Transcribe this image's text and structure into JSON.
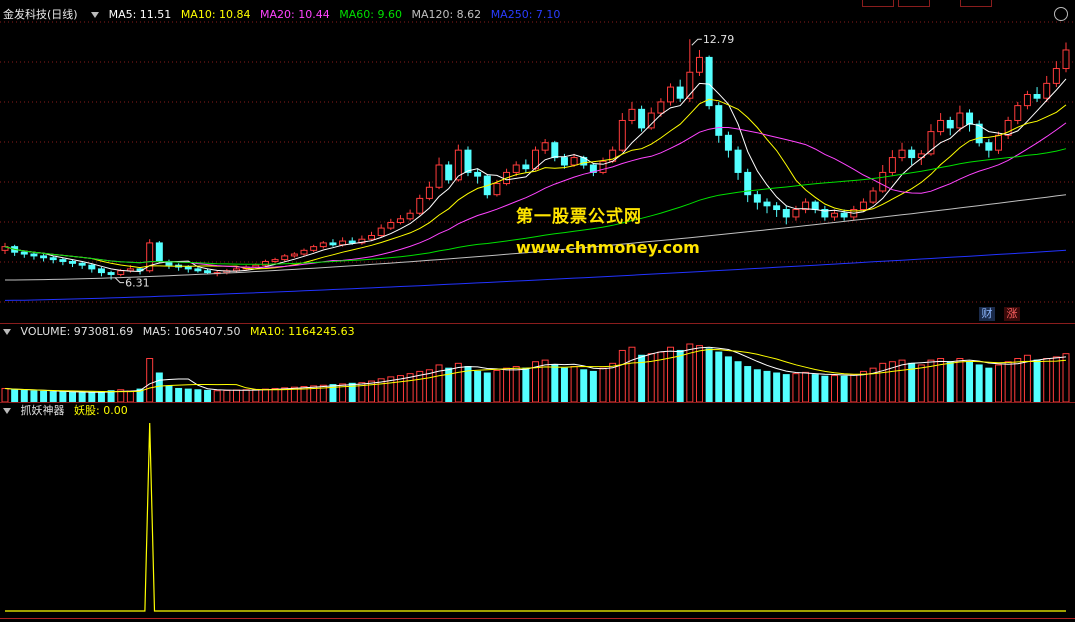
{
  "price_header": {
    "title": "金发科技(日线)",
    "ma5": "MA5: 11.51",
    "ma10": "MA10: 10.84",
    "ma20": "MA20: 10.44",
    "ma60": "MA60: 9.60",
    "ma120": "MA120: 8.62",
    "ma250": "MA250: 7.10"
  },
  "volume_header": {
    "volume": "VOLUME: 973081.69",
    "ma5": "MA5: 1065407.50",
    "ma10": "MA10: 1164245.63"
  },
  "indicator_header": {
    "name": "抓妖神器",
    "value": "妖股: 0.00"
  },
  "annotations": {
    "high": "12.79",
    "low": "6.31"
  },
  "watermark": {
    "line1": "第一股票公式网",
    "line2": "www.chnmoney.com"
  },
  "badges": {
    "cai": "财",
    "zhang": "涨"
  },
  "colors": {
    "up": "#ff3c3c",
    "down": "#54ffff",
    "ma5": "#ffffff",
    "ma10": "#ffff00",
    "ma20": "#ff44ff",
    "ma60": "#00e000",
    "ma120": "#c0c0c0",
    "ma250": "#2233ff",
    "grid": "#8a1d1d",
    "indicator": "#ffff00"
  },
  "chart_data": [
    {
      "type": "candlestick",
      "title": "金发科技(日线)",
      "price_range": [
        5.6,
        13.2
      ],
      "grid": true,
      "annotations": [
        {
          "label": "12.79",
          "kind": "high"
        },
        {
          "label": "6.31",
          "kind": "low"
        }
      ],
      "candles": [
        [
          7.1,
          7.2,
          7.3,
          7.0
        ],
        [
          7.2,
          7.05,
          7.25,
          6.95
        ],
        [
          7.05,
          7.0,
          7.1,
          6.9
        ],
        [
          7.0,
          6.95,
          7.05,
          6.85
        ],
        [
          6.95,
          6.9,
          7.0,
          6.8
        ],
        [
          6.9,
          6.85,
          6.95,
          6.75
        ],
        [
          6.85,
          6.8,
          6.9,
          6.7
        ],
        [
          6.8,
          6.75,
          6.85,
          6.65
        ],
        [
          6.75,
          6.7,
          6.8,
          6.6
        ],
        [
          6.7,
          6.6,
          6.75,
          6.5
        ],
        [
          6.6,
          6.5,
          6.65,
          6.4
        ],
        [
          6.5,
          6.45,
          6.55,
          6.31
        ],
        [
          6.45,
          6.55,
          6.6,
          6.4
        ],
        [
          6.55,
          6.6,
          6.7,
          6.5
        ],
        [
          6.6,
          6.55,
          6.65,
          6.45
        ],
        [
          6.55,
          7.3,
          7.4,
          6.5
        ],
        [
          7.3,
          6.8,
          7.35,
          6.75
        ],
        [
          6.8,
          6.7,
          6.85,
          6.6
        ],
        [
          6.7,
          6.65,
          6.75,
          6.55
        ],
        [
          6.65,
          6.6,
          6.7,
          6.5
        ],
        [
          6.6,
          6.55,
          6.65,
          6.5
        ],
        [
          6.55,
          6.5,
          6.6,
          6.45
        ],
        [
          6.5,
          6.5,
          6.55,
          6.4
        ],
        [
          6.5,
          6.55,
          6.6,
          6.45
        ],
        [
          6.55,
          6.6,
          6.65,
          6.5
        ],
        [
          6.6,
          6.65,
          6.7,
          6.55
        ],
        [
          6.65,
          6.7,
          6.75,
          6.6
        ],
        [
          6.7,
          6.8,
          6.85,
          6.65
        ],
        [
          6.8,
          6.85,
          6.9,
          6.75
        ],
        [
          6.85,
          6.95,
          7.0,
          6.8
        ],
        [
          6.95,
          7.0,
          7.05,
          6.9
        ],
        [
          7.0,
          7.1,
          7.15,
          6.95
        ],
        [
          7.1,
          7.2,
          7.25,
          7.05
        ],
        [
          7.2,
          7.3,
          7.35,
          7.15
        ],
        [
          7.3,
          7.25,
          7.4,
          7.2
        ],
        [
          7.25,
          7.35,
          7.45,
          7.2
        ],
        [
          7.35,
          7.3,
          7.45,
          7.25
        ],
        [
          7.3,
          7.4,
          7.5,
          7.25
        ],
        [
          7.4,
          7.5,
          7.6,
          7.35
        ],
        [
          7.5,
          7.7,
          7.8,
          7.45
        ],
        [
          7.7,
          7.85,
          7.95,
          7.65
        ],
        [
          7.85,
          7.95,
          8.05,
          7.8
        ],
        [
          7.95,
          8.1,
          8.2,
          7.9
        ],
        [
          8.1,
          8.5,
          8.6,
          8.05
        ],
        [
          8.5,
          8.8,
          8.95,
          8.45
        ],
        [
          8.8,
          9.4,
          9.6,
          8.75
        ],
        [
          9.4,
          9.0,
          9.5,
          8.9
        ],
        [
          9.0,
          9.8,
          9.95,
          8.95
        ],
        [
          9.8,
          9.2,
          9.9,
          9.1
        ],
        [
          9.2,
          9.1,
          9.3,
          8.9
        ],
        [
          9.1,
          8.6,
          9.15,
          8.5
        ],
        [
          8.6,
          8.9,
          9.0,
          8.55
        ],
        [
          8.9,
          9.2,
          9.3,
          8.85
        ],
        [
          9.2,
          9.4,
          9.5,
          9.1
        ],
        [
          9.4,
          9.3,
          9.55,
          9.2
        ],
        [
          9.3,
          9.8,
          9.9,
          9.25
        ],
        [
          9.8,
          10.0,
          10.1,
          9.7
        ],
        [
          10.0,
          9.6,
          10.05,
          9.5
        ],
        [
          9.6,
          9.4,
          9.7,
          9.3
        ],
        [
          9.4,
          9.6,
          9.7,
          9.35
        ],
        [
          9.6,
          9.4,
          9.65,
          9.3
        ],
        [
          9.4,
          9.2,
          9.45,
          9.1
        ],
        [
          9.2,
          9.5,
          9.6,
          9.15
        ],
        [
          9.5,
          9.8,
          9.9,
          9.45
        ],
        [
          9.8,
          10.6,
          10.8,
          9.75
        ],
        [
          10.6,
          10.9,
          11.1,
          10.5
        ],
        [
          10.9,
          10.4,
          11.0,
          10.3
        ],
        [
          10.4,
          10.8,
          10.95,
          10.35
        ],
        [
          10.8,
          11.1,
          11.2,
          10.7
        ],
        [
          11.1,
          11.5,
          11.6,
          11.0
        ],
        [
          11.5,
          11.2,
          11.7,
          11.1
        ],
        [
          11.2,
          11.9,
          12.79,
          11.1
        ],
        [
          11.9,
          12.3,
          12.5,
          11.8
        ],
        [
          12.3,
          11.0,
          12.35,
          10.9
        ],
        [
          11.0,
          10.2,
          11.1,
          10.0
        ],
        [
          10.2,
          9.8,
          10.3,
          9.6
        ],
        [
          9.8,
          9.2,
          9.9,
          9.0
        ],
        [
          9.2,
          8.6,
          9.3,
          8.4
        ],
        [
          8.6,
          8.4,
          8.7,
          8.2
        ],
        [
          8.4,
          8.3,
          8.5,
          8.1
        ],
        [
          8.3,
          8.2,
          8.4,
          8.0
        ],
        [
          8.2,
          8.0,
          8.3,
          7.8
        ],
        [
          8.0,
          8.2,
          8.3,
          7.9
        ],
        [
          8.2,
          8.4,
          8.5,
          8.1
        ],
        [
          8.4,
          8.2,
          8.45,
          8.1
        ],
        [
          8.2,
          8.0,
          8.3,
          7.9
        ],
        [
          8.0,
          8.1,
          8.2,
          7.9
        ],
        [
          8.1,
          8.0,
          8.2,
          7.9
        ],
        [
          8.0,
          8.2,
          8.3,
          7.9
        ],
        [
          8.2,
          8.4,
          8.5,
          8.15
        ],
        [
          8.4,
          8.7,
          8.8,
          8.35
        ],
        [
          8.7,
          9.2,
          9.4,
          8.65
        ],
        [
          9.2,
          9.6,
          9.8,
          9.1
        ],
        [
          9.6,
          9.8,
          10.0,
          9.5
        ],
        [
          9.8,
          9.6,
          9.9,
          9.4
        ],
        [
          9.6,
          9.7,
          9.8,
          9.4
        ],
        [
          9.7,
          10.3,
          10.5,
          9.65
        ],
        [
          10.3,
          10.6,
          10.8,
          10.2
        ],
        [
          10.6,
          10.4,
          10.7,
          10.2
        ],
        [
          10.4,
          10.8,
          11.0,
          10.3
        ],
        [
          10.8,
          10.5,
          10.9,
          10.3
        ],
        [
          10.5,
          10.0,
          10.6,
          9.9
        ],
        [
          10.0,
          9.8,
          10.1,
          9.6
        ],
        [
          9.8,
          10.2,
          10.3,
          9.7
        ],
        [
          10.2,
          10.6,
          10.7,
          10.1
        ],
        [
          10.6,
          11.0,
          11.1,
          10.5
        ],
        [
          11.0,
          11.3,
          11.4,
          10.9
        ],
        [
          11.3,
          11.2,
          11.5,
          11.1
        ],
        [
          11.2,
          11.6,
          11.8,
          11.1
        ],
        [
          11.6,
          12.0,
          12.2,
          11.5
        ],
        [
          12.0,
          12.5,
          12.7,
          11.9
        ]
      ],
      "ma_series": [
        {
          "name": "MA5",
          "last": 11.51
        },
        {
          "name": "MA10",
          "last": 10.84
        },
        {
          "name": "MA20",
          "last": 10.44
        },
        {
          "name": "MA60",
          "last": 9.6
        },
        {
          "name": "MA120",
          "last": 8.62
        },
        {
          "name": "MA250",
          "last": 7.1
        }
      ]
    },
    {
      "type": "bar",
      "title": "VOLUME",
      "volume_range": [
        0,
        1800000
      ],
      "values": [
        420000,
        380000,
        360000,
        340000,
        330000,
        320000,
        310000,
        300000,
        290000,
        300000,
        320000,
        350000,
        380000,
        340000,
        400000,
        1350000,
        900000,
        500000,
        420000,
        400000,
        380000,
        360000,
        350000,
        360000,
        370000,
        380000,
        390000,
        400000,
        420000,
        440000,
        460000,
        480000,
        500000,
        520000,
        540000,
        560000,
        580000,
        600000,
        650000,
        720000,
        780000,
        820000,
        880000,
        950000,
        1000000,
        1150000,
        1050000,
        1200000,
        1100000,
        950000,
        900000,
        980000,
        1050000,
        1100000,
        1050000,
        1250000,
        1300000,
        1150000,
        1050000,
        1100000,
        1000000,
        950000,
        1050000,
        1200000,
        1600000,
        1700000,
        1450000,
        1500000,
        1550000,
        1700000,
        1600000,
        1800000,
        1750000,
        1650000,
        1550000,
        1400000,
        1250000,
        1100000,
        1000000,
        950000,
        900000,
        850000,
        880000,
        920000,
        850000,
        800000,
        820000,
        800000,
        850000,
        950000,
        1050000,
        1200000,
        1250000,
        1300000,
        1200000,
        1150000,
        1300000,
        1350000,
        1250000,
        1350000,
        1250000,
        1150000,
        1050000,
        1150000,
        1250000,
        1350000,
        1450000,
        1300000,
        1350000,
        1400000,
        1500000
      ],
      "series": [
        {
          "name": "MA5",
          "last": 1065407.5
        },
        {
          "name": "MA10",
          "last": 1164245.63
        }
      ]
    },
    {
      "type": "line",
      "title": "抓妖神器",
      "series": [
        {
          "name": "妖股",
          "last": 0.0,
          "spike_index": 15
        }
      ],
      "ylim": [
        0,
        1
      ]
    }
  ]
}
